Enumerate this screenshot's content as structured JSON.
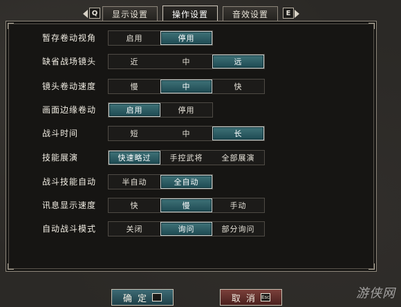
{
  "tabs": {
    "prev_key": "Q",
    "next_key": "E",
    "items": [
      {
        "label": "显示设置",
        "active": false
      },
      {
        "label": "操作设置",
        "active": true
      },
      {
        "label": "音效设置",
        "active": false
      }
    ]
  },
  "settings": [
    {
      "label": "暂存卷动视角",
      "options": [
        "启用",
        "停用"
      ],
      "selected": 1
    },
    {
      "label": "缺省战场镜头",
      "options": [
        "近",
        "中",
        "远"
      ],
      "selected": 2
    },
    {
      "label": "镜头卷动速度",
      "options": [
        "慢",
        "中",
        "快"
      ],
      "selected": 1
    },
    {
      "label": "画面边缘卷动",
      "options": [
        "启用",
        "停用"
      ],
      "selected": 0
    },
    {
      "label": "战斗时间",
      "options": [
        "短",
        "中",
        "长"
      ],
      "selected": 2
    },
    {
      "label": "技能展演",
      "options": [
        "快速略过",
        "手控武将",
        "全部展演"
      ],
      "selected": 0
    },
    {
      "label": "战斗技能自动",
      "options": [
        "半自动",
        "全自动"
      ],
      "selected": 1
    },
    {
      "label": "讯息显示速度",
      "options": [
        "快",
        "慢",
        "手动"
      ],
      "selected": 1
    },
    {
      "label": "自动战斗模式",
      "options": [
        "关闭",
        "询问",
        "部分询问"
      ],
      "selected": 1
    }
  ],
  "buttons": {
    "confirm_label": "确 定",
    "confirm_key": "",
    "cancel_label": "取 消",
    "cancel_key": "Esc"
  },
  "watermark": "游侠网"
}
